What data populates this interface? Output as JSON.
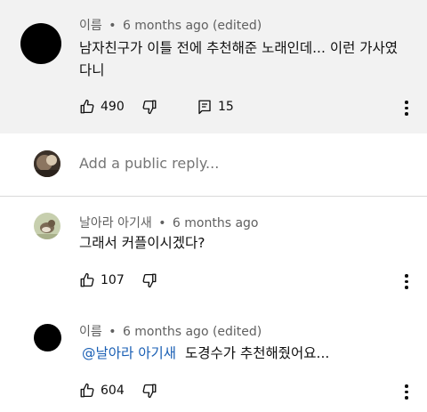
{
  "comments": [
    {
      "author": "이름",
      "separator": "•",
      "time": "6 months ago (edited)",
      "text_lines": [
        "남자친구가 이틀 전에 추천해준 노래인데... 이런 가사였",
        "다니"
      ],
      "likes": "490",
      "replies": "15"
    }
  ],
  "reply_box": {
    "placeholder": "Add a public reply..."
  },
  "replies": [
    {
      "author": "날아라 아기새",
      "separator": "•",
      "time": "6 months ago",
      "text": "그래서 커플이시겠다?",
      "likes": "107"
    },
    {
      "author": "이름",
      "separator": "•",
      "time": "6 months ago (edited)",
      "mention": "@날아라 아기새",
      "text": "도경수가 추천해줬어요...",
      "likes": "604"
    }
  ],
  "icons": [
    "thumbs-up-icon",
    "thumbs-down-icon",
    "reply-comment-icon",
    "more-vert-icon"
  ],
  "colors": {
    "highlight_bg": "#f2f2f2",
    "mention": "#1a5fb4",
    "meta_text": "#606060"
  }
}
